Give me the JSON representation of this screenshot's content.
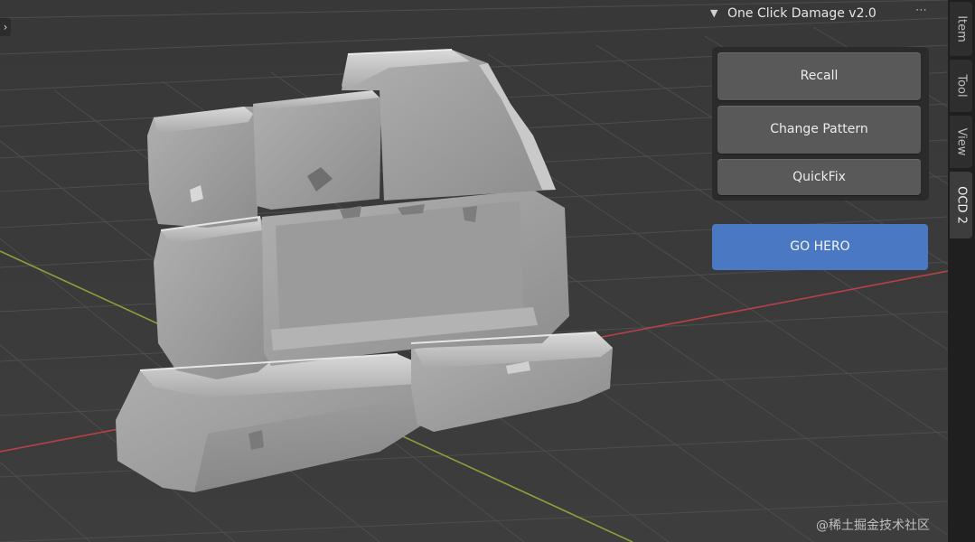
{
  "panel": {
    "title": "One Click Damage v2.0",
    "collapse_icon": "chevron-down-icon",
    "drag_handle_icon": "drag-handle-icon",
    "buttons": {
      "recall": "Recall",
      "change_pattern": "Change Pattern",
      "quickfix": "QuickFix"
    },
    "go_hero": "GO HERO"
  },
  "tabs": [
    "Item",
    "Tool",
    "View",
    "OCD 2"
  ],
  "active_tab": "OCD 2",
  "watermark": "@稀土掘金技术社区",
  "colors": {
    "viewport_bg": "#3a3a3a",
    "grid_line": "#4d4d4d",
    "x_axis": "#b8404a",
    "y_axis": "#8aa03a",
    "button": "#595959",
    "button_box": "#2b2b2b",
    "go_hero": "#4a78c2",
    "tab_bar": "#1f1f1f"
  }
}
